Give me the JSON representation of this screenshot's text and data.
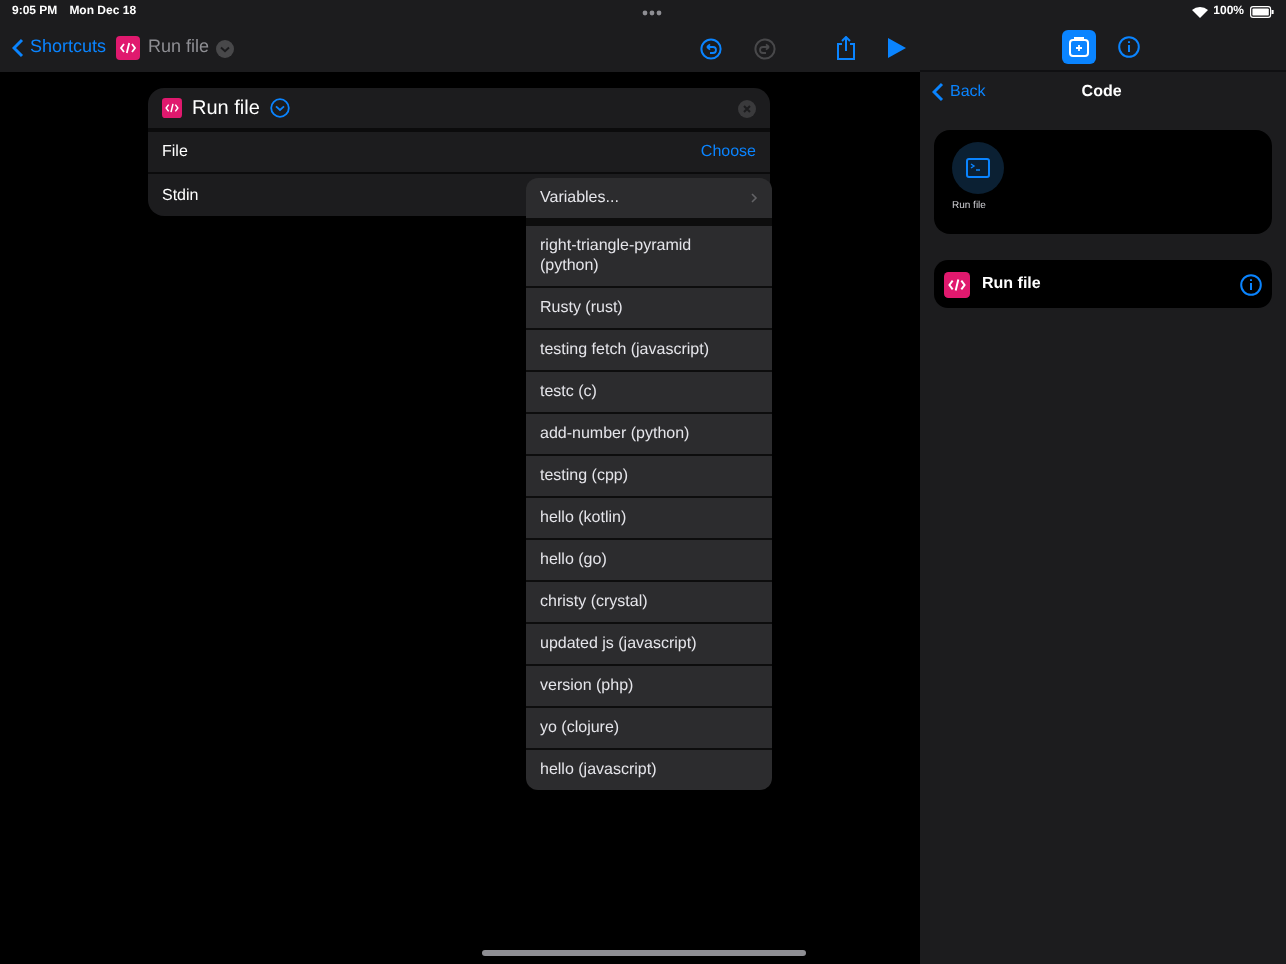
{
  "status_bar": {
    "time": "9:05 PM",
    "date": "Mon Dec 18",
    "battery": "100%"
  },
  "nav": {
    "back": "Shortcuts",
    "title": "Run file"
  },
  "action_card": {
    "title": "Run file",
    "rows": [
      {
        "label": "File",
        "value": "Choose"
      },
      {
        "label": "Stdin"
      }
    ]
  },
  "menu": [
    {
      "label": "Variables...",
      "kind": "submenu"
    },
    {
      "label": "right-triangle-pyramid (python)",
      "kind": "item"
    },
    {
      "label": "Rusty (rust)",
      "kind": "item"
    },
    {
      "label": "testing fetch (javascript)",
      "kind": "item"
    },
    {
      "label": "testc (c)",
      "kind": "item"
    },
    {
      "label": "add-number (python)",
      "kind": "item"
    },
    {
      "label": "testing (cpp)",
      "kind": "item"
    },
    {
      "label": "hello (kotlin)",
      "kind": "item"
    },
    {
      "label": "hello (go)",
      "kind": "item"
    },
    {
      "label": "christy (crystal)",
      "kind": "item"
    },
    {
      "label": "updated js (javascript)",
      "kind": "item"
    },
    {
      "label": "version (php)",
      "kind": "item"
    },
    {
      "label": "yo (clojure)",
      "kind": "item"
    },
    {
      "label": "hello (javascript)",
      "kind": "item"
    }
  ],
  "sidebar": {
    "tabs": [
      {
        "kind": "actions",
        "selected": true
      },
      {
        "kind": "info",
        "selected": false
      }
    ],
    "back": "Back",
    "title": "Code",
    "tile": {
      "label": "Run file"
    },
    "action": {
      "title": "Run file"
    }
  }
}
